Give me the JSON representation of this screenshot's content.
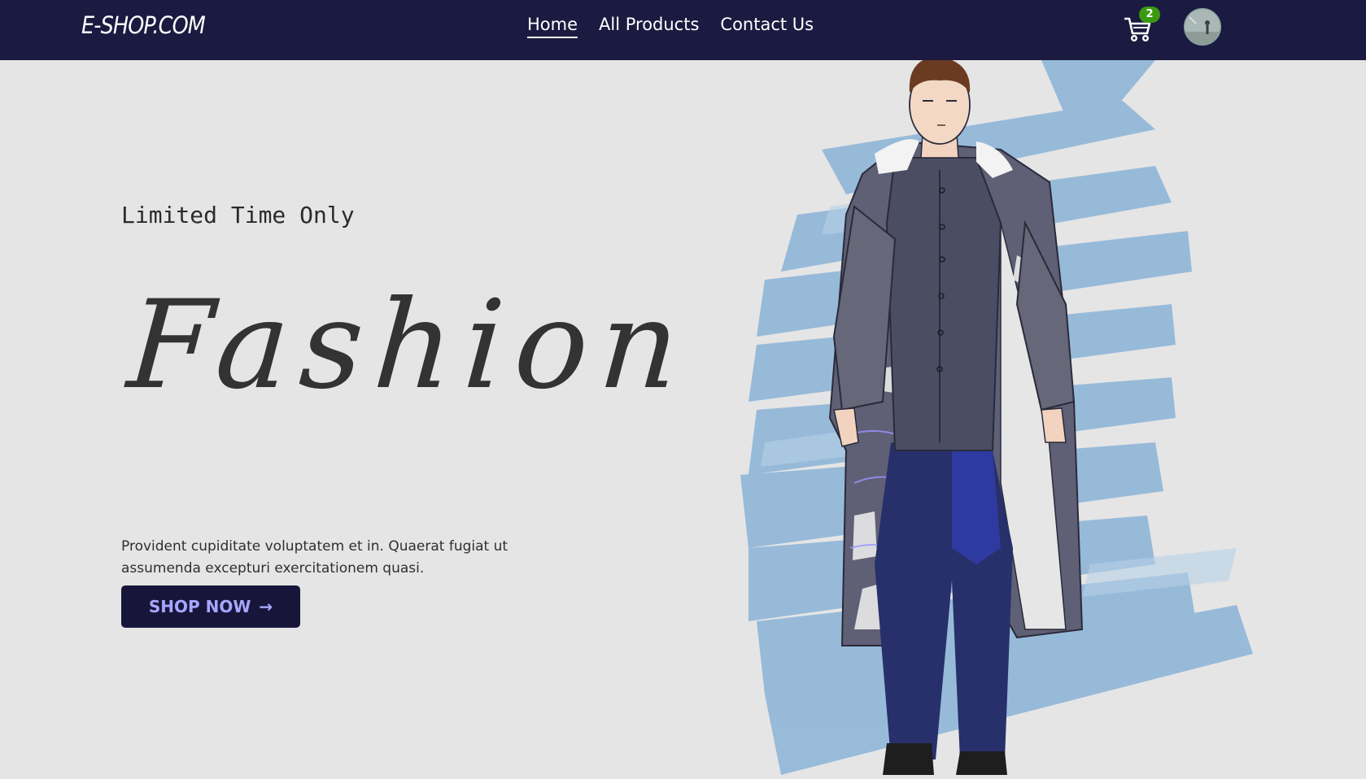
{
  "header": {
    "logo": "E-SHOP.COM",
    "nav": [
      {
        "label": "Home",
        "active": true
      },
      {
        "label": "All Products",
        "active": false
      },
      {
        "label": "Contact Us",
        "active": false
      }
    ],
    "cart_icon": "shopping-cart-icon",
    "cart_count": "2",
    "avatar": "user-avatar"
  },
  "hero": {
    "kicker": "Limited Time Only",
    "title": "Fashion",
    "description": "Provident cupiditate voluptatem et in. Quaerat fugiat ut assumenda excepturi exercitationem quasi.",
    "cta_label": "SHOP NOW",
    "cta_icon": "arrow-right-icon",
    "image": "fashion-model-illustration"
  },
  "colors": {
    "navbar": "#1b1a40",
    "background": "#e5e5e5",
    "button": "#17163a",
    "button_text": "#a7a6ff",
    "badge": "#3a9a0f",
    "brush": "#8fb6d8"
  }
}
